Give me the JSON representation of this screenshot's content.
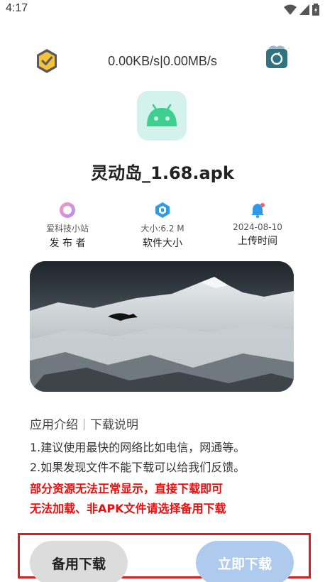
{
  "status_bar": {
    "time": "4:17"
  },
  "header": {
    "speed": "0.00KB/s|0.00MB/s"
  },
  "app": {
    "name": "灵动岛_1.68.apk"
  },
  "info": [
    {
      "small": "爱科技小站",
      "label": "发 布 者"
    },
    {
      "small": "大小:6.2 M",
      "label": "软件大小"
    },
    {
      "small": "2024-08-10",
      "label": "上传时间"
    }
  ],
  "intro": {
    "tab_intro": "应用介绍",
    "tab_download": "下载说明",
    "line1": "1.建议使用最快的网络比如电信，网通等。",
    "line2": "2.如果发现文件不能下载可以给我们反馈。",
    "warn1": "部分资源无法正常显示，直接下载即可",
    "warn2": "无法加载、非APK文件请选择备用下载"
  },
  "buttons": {
    "backup": "备用下载",
    "download": "立即下载"
  },
  "colors": {
    "accent_red": "#e8100f",
    "download_btn": "#aecbee",
    "backup_btn": "#dcdcdc",
    "app_icon_bg": "#d4f2ec"
  }
}
